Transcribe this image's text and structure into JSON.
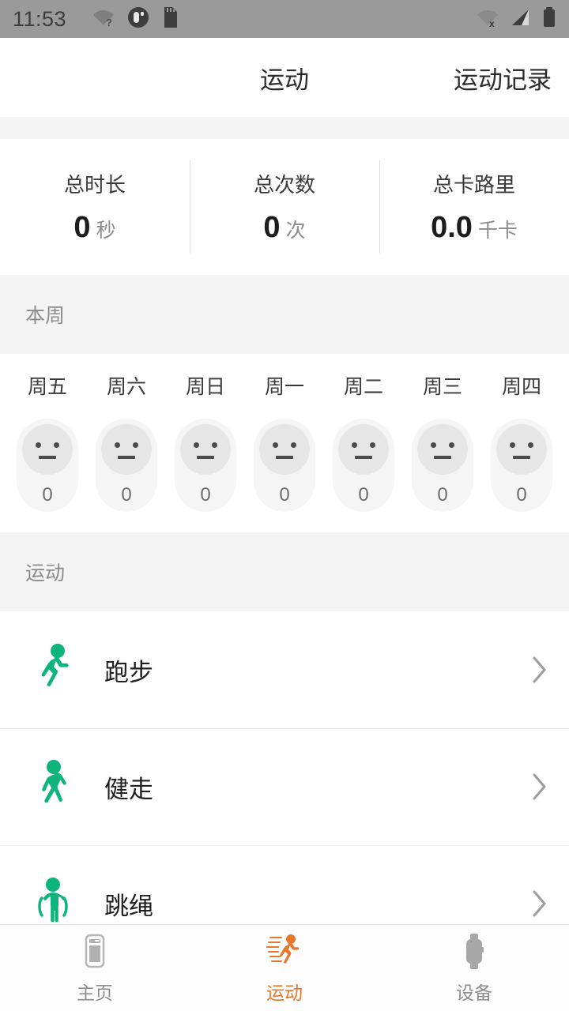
{
  "status_bar": {
    "time": "11:53",
    "left_icons": [
      "wifi-question-icon",
      "sync-circle-icon",
      "sd-card-icon"
    ],
    "right_icons": [
      "wifi-off-icon",
      "cellular-signal-icon",
      "battery-full-icon"
    ]
  },
  "header": {
    "title": "运动",
    "records_link": "运动记录"
  },
  "summary": {
    "stats": [
      {
        "label": "总时长",
        "value": "0",
        "unit": "秒"
      },
      {
        "label": "总次数",
        "value": "0",
        "unit": "次"
      },
      {
        "label": "总卡路里",
        "value": "0.0",
        "unit": "千卡"
      }
    ]
  },
  "week_section": {
    "title": "本周",
    "days": [
      {
        "name": "周五",
        "count": "0",
        "face": "neutral-face-icon"
      },
      {
        "name": "周六",
        "count": "0",
        "face": "neutral-face-icon"
      },
      {
        "name": "周日",
        "count": "0",
        "face": "neutral-face-icon"
      },
      {
        "name": "周一",
        "count": "0",
        "face": "neutral-face-icon"
      },
      {
        "name": "周二",
        "count": "0",
        "face": "neutral-face-icon"
      },
      {
        "name": "周三",
        "count": "0",
        "face": "neutral-face-icon"
      },
      {
        "name": "周四",
        "count": "0",
        "face": "neutral-face-icon"
      }
    ]
  },
  "exercise_section": {
    "title": "运动",
    "items": [
      {
        "label": "跑步",
        "icon": "running-person-icon"
      },
      {
        "label": "健走",
        "icon": "walking-person-icon"
      },
      {
        "label": "跳绳",
        "icon": "jump-rope-person-icon"
      }
    ]
  },
  "bottom_nav": {
    "items": [
      {
        "label": "主页",
        "icon": "home-phone-icon",
        "active": false
      },
      {
        "label": "运动",
        "icon": "running-person-icon",
        "active": true
      },
      {
        "label": "设备",
        "icon": "smartwatch-icon",
        "active": false
      }
    ]
  },
  "colors": {
    "accent_green": "#0eb47c",
    "accent_orange": "#e8772e",
    "statusbar_gray": "#9a9a9a",
    "band_gray": "#f4f4f4"
  }
}
